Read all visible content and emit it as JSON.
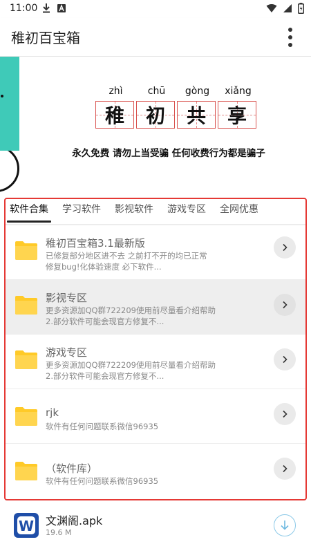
{
  "status_bar": {
    "time": "11:00",
    "left_icons": [
      "download-icon",
      "notification-a-icon"
    ],
    "right_icons": [
      "wifi-icon",
      "cellular-signal-icon",
      "battery-icon"
    ]
  },
  "app_bar": {
    "title": "稚初百宝箱",
    "menu_icon": "more-vert-icon"
  },
  "banner": {
    "pinyin": [
      "zhì",
      "chū",
      "gòng",
      "xiǎng"
    ],
    "chars": [
      "稚",
      "初",
      "共",
      "享"
    ],
    "slogan": "永久免费 请勿上当受骗 任何收费行为都是骗子"
  },
  "tabs": [
    {
      "label": "软件合集",
      "active": true
    },
    {
      "label": "学习软件",
      "active": false
    },
    {
      "label": "影视软件",
      "active": false
    },
    {
      "label": "游戏专区",
      "active": false
    },
    {
      "label": "全网优惠",
      "active": false
    }
  ],
  "items": [
    {
      "title": "稚初百宝箱3.1最新版",
      "desc": [
        "已修复部分地区进不去 之前打不开的均已正常",
        "修复bug!化体验速度 必下软件..."
      ],
      "highlighted": false,
      "icon": "folder-icon"
    },
    {
      "title": "影视专区",
      "desc": [
        "更多资源加QQ群722209使用前尽量看介绍帮助",
        "2.部分软件可能会现官方修复不..."
      ],
      "highlighted": true,
      "icon": "folder-icon"
    },
    {
      "title": "游戏专区",
      "desc": [
        "更多资源加QQ群722209使用前尽量看介绍帮助",
        "2.部分软件可能会现官方修复不..."
      ],
      "highlighted": false,
      "icon": "folder-icon"
    },
    {
      "title": "rjk",
      "desc": [
        "软件有任何问题联系微信96935"
      ],
      "highlighted": false,
      "icon": "folder-icon"
    },
    {
      "title": "（软件库）",
      "desc": [
        "软件有任何问题联系微信96935"
      ],
      "highlighted": false,
      "icon": "folder-icon"
    }
  ],
  "download": {
    "name": "文渊阁.apk",
    "size": "19.6 M",
    "icon": "wenyuange-app-icon",
    "action_icon": "download-arrow-icon"
  },
  "colors": {
    "highlight_frame": "#e53935",
    "banner_accent": "#3fcab8",
    "folder": "#ffd54f",
    "download_ring": "#8cc9e8"
  }
}
